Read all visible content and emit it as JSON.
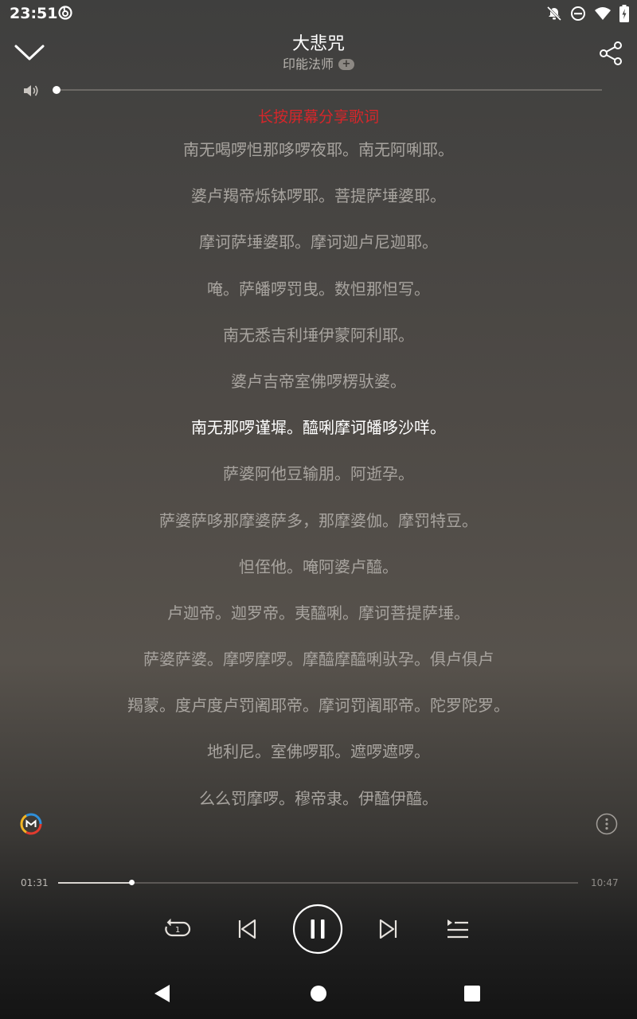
{
  "status_bar": {
    "time": "23:51"
  },
  "header": {
    "title": "大悲咒",
    "artist": "印能法师",
    "follow_label": "+"
  },
  "lyrics": {
    "hint": "长按屏幕分享歌词",
    "active_index": 6,
    "lines": [
      "南无喝啰怛那哆啰夜耶。南无阿唎耶。",
      "婆卢羯帝烁钵啰耶。菩提萨埵婆耶。",
      "摩诃萨埵婆耶。摩诃迦卢尼迦耶。",
      "唵。萨皤啰罚曳。数怛那怛写。",
      "南无悉吉利埵伊蒙阿利耶。",
      "婆卢吉帝室佛啰楞驮婆。",
      "南无那啰谨墀。醯唎摩诃皤哆沙咩。",
      "萨婆阿他豆输朋。阿逝孕。",
      "萨婆萨哆那摩婆萨多，那摩婆伽。摩罚特豆。",
      "怛侄他。唵阿婆卢醯。",
      "卢迦帝。迦罗帝。夷醯唎。摩诃菩提萨埵。",
      "萨婆萨婆。摩啰摩啰。摩醯摩醯唎驮孕。俱卢俱卢",
      "羯蒙。度卢度卢罚阇耶帝。摩诃罚阇耶帝。陀罗陀罗。",
      "地利尼。室佛啰耶。遮啰遮啰。",
      "么么罚摩啰。穆帝隶。伊醯伊醯。"
    ]
  },
  "player": {
    "current_time": "01:31",
    "total_time": "10:47",
    "progress": 0.141,
    "volume": 0.0,
    "state": "playing"
  },
  "icons": {
    "collapse": "chevron-down-icon",
    "share": "share-icon",
    "volume": "speaker-icon",
    "effect": "sound-effect-icon",
    "more": "more-vertical-icon",
    "loop": "repeat-one-icon",
    "prev": "skip-previous-icon",
    "pause": "pause-icon",
    "next": "skip-next-icon",
    "playlist": "playlist-icon"
  },
  "colors": {
    "hint": "#d6262a",
    "active_lyric": "#ffffff",
    "inactive_lyric": "#a8a49f"
  }
}
